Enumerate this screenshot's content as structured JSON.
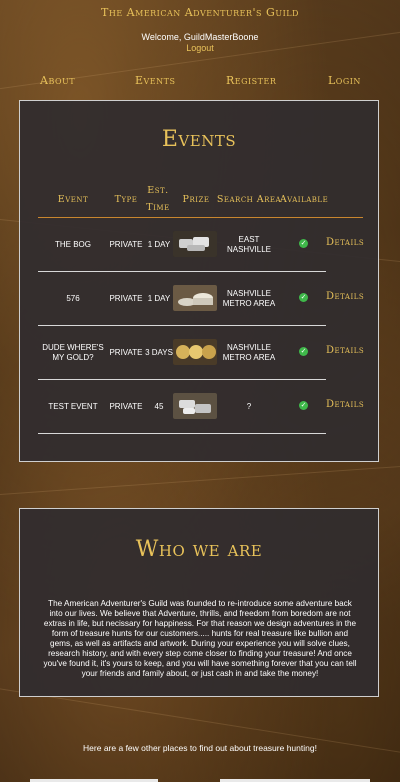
{
  "site": {
    "title": "The American Adventurer's Guild"
  },
  "user": {
    "welcome": "Welcome, GuildMasterBoone",
    "logout_label": "Logout"
  },
  "nav": {
    "about": "About",
    "events": "Events",
    "register": "Register",
    "login": "Login"
  },
  "events": {
    "title": "Events",
    "headers": {
      "event": "Event",
      "type": "Type",
      "est_time": "Est. Time",
      "prize": "Prize",
      "search_area": "Search Area",
      "available": "Available"
    },
    "rows": [
      {
        "event": "THE BOG",
        "type": "PRIVATE",
        "est_time": "1 DAY",
        "prize_icon": "silver-bars-image",
        "search_area": "EAST NASHVILLE",
        "available_icon": "check-icon",
        "details": "Details"
      },
      {
        "event": "576",
        "type": "PRIVATE",
        "est_time": "1 DAY",
        "prize_icon": "coin-stack-image",
        "search_area": "NASHVILLE METRO AREA",
        "available_icon": "check-icon",
        "details": "Details"
      },
      {
        "event": "DUDE WHERE'S MY GOLD?",
        "type": "PRIVATE",
        "est_time": "3 DAYS",
        "prize_icon": "gold-coins-image",
        "search_area": "NASHVILLE METRO AREA",
        "available_icon": "check-icon",
        "details": "Details"
      },
      {
        "event": "TEST EVENT",
        "type": "PRIVATE",
        "est_time": "45",
        "prize_icon": "silver-bullion-image",
        "search_area": "?",
        "available_icon": "check-icon",
        "details": "Details"
      }
    ]
  },
  "who": {
    "title": "Who we are",
    "body": "The American Adventurer's Guild was founded to re-introduce some adventure back into our lives. We believe that Adventure, thrills, and freedom from boredom are not extras in life, but necissary for happiness. For that reason we design adventures in the form of treasure hunts for our customers..... hunts for real treasure like bullion and gems, as well as artifacts and artwork. During your experience you will solve clues, research history, and with every step come closer to finding your treasure! And once you've found it, it's yours to keep, and you will have something forever that you can tell your friends and family about, or just cash in and take the money!"
  },
  "footer": {
    "links_text": "Here are a few other places to find out about treasure hunting!"
  },
  "colors": {
    "accent": "#e8c25a",
    "panel": "#302c2e",
    "rule": "#c9862e",
    "check": "#3fb84a"
  }
}
